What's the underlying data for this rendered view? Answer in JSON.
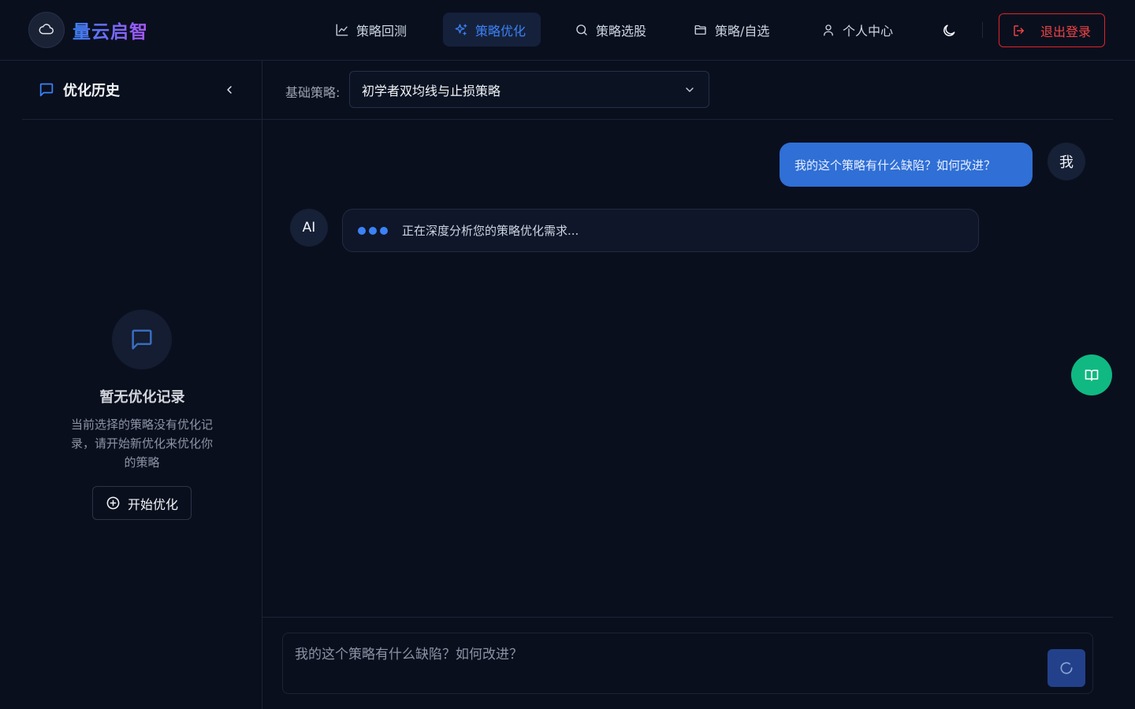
{
  "app": {
    "title": "量云启智",
    "logo_icon": "cloud-logo-icon"
  },
  "nav": {
    "items": [
      {
        "label": "策略回测",
        "icon": "line-chart-icon",
        "active": false
      },
      {
        "label": "策略优化",
        "icon": "sparkles-icon",
        "active": true
      },
      {
        "label": "策略选股",
        "icon": "search-icon",
        "active": false
      },
      {
        "label": "策略/自选",
        "icon": "folder-icon",
        "active": false
      },
      {
        "label": "个人中心",
        "icon": "user-icon",
        "active": false
      }
    ],
    "theme_icon": "moon-icon",
    "logout_label": "退出登录",
    "logout_icon": "logout-icon"
  },
  "sidebar": {
    "title": "优化历史",
    "empty_title": "暂无优化记录",
    "empty_desc": "当前选择的策略没有优化记录，请开始新优化来优化你的策略",
    "start_label": "开始优化"
  },
  "main": {
    "base_label": "基础策略:",
    "base_strategy": "初学者双均线与止损策略"
  },
  "chat": {
    "messages": [
      {
        "role": "user",
        "avatar": "我",
        "text": "我的这个策略有什么缺陷？如何改进？"
      },
      {
        "role": "ai",
        "avatar": "AI",
        "text": "正在深度分析您的策略优化需求..."
      }
    ],
    "input_placeholder": "我的这个策略有什么缺陷？如何改进？"
  },
  "colors": {
    "background": "#0a0f1e",
    "accent": "#3b82f6",
    "user_bubble": "#2f6fd6",
    "danger": "#ef4444",
    "fab": "#10b981"
  }
}
